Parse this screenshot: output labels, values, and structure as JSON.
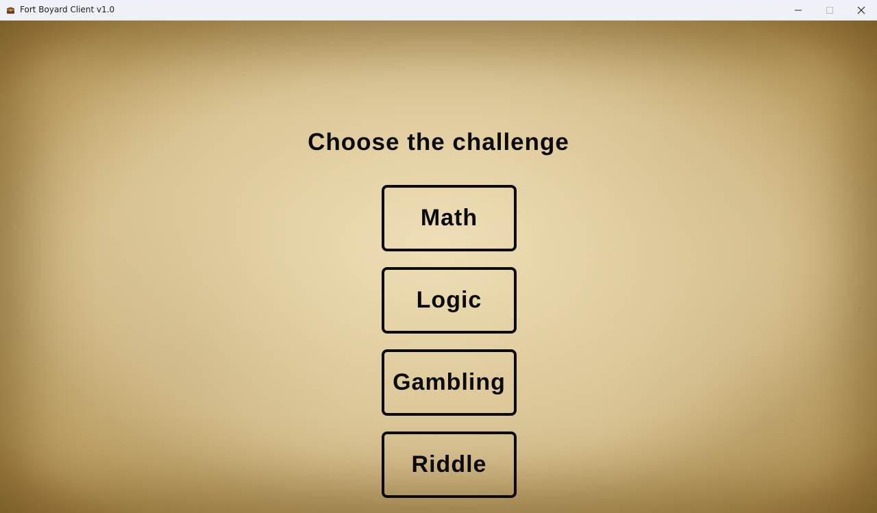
{
  "window": {
    "title": "Fort Boyard Client v1.0",
    "app_icon": "treasure-chest-icon",
    "controls": [
      "minimize-icon",
      "maximize-icon",
      "close-icon"
    ]
  },
  "main": {
    "heading": "Choose the challenge",
    "challenges": [
      {
        "label": "Math"
      },
      {
        "label": "Logic"
      },
      {
        "label": "Gambling"
      },
      {
        "label": "Riddle"
      }
    ]
  },
  "colors": {
    "text": "#0a0a0a",
    "titlebar": "#eef2f8",
    "parchment": "#d2bb88"
  }
}
